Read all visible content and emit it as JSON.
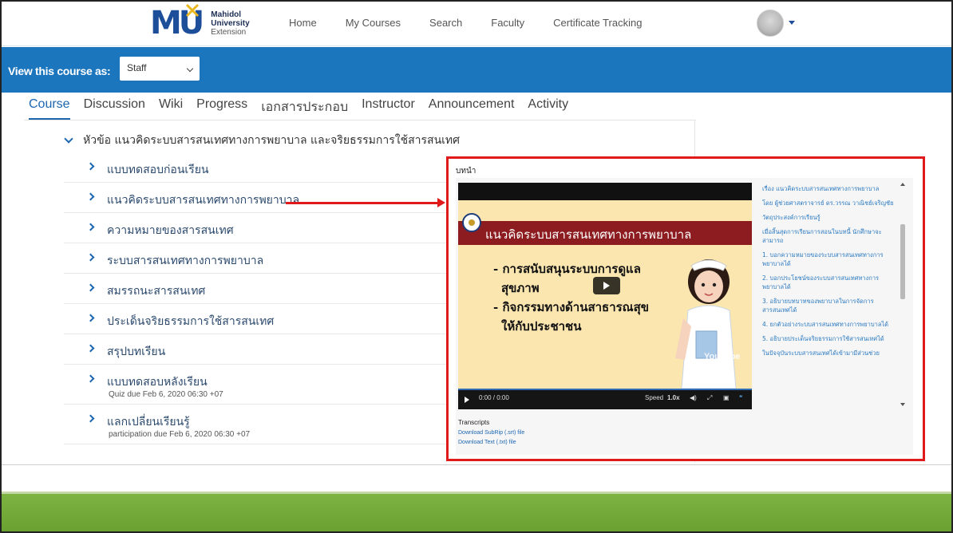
{
  "header": {
    "logo": {
      "mark": "MU",
      "line1": "Mahidol",
      "line2": "University",
      "line3": "Extension"
    },
    "nav": [
      "Home",
      "My Courses",
      "Search",
      "Faculty",
      "Certificate Tracking"
    ]
  },
  "viewbar": {
    "label": "View this course as:",
    "select_value": "Staff"
  },
  "tabs": [
    "Course",
    "Discussion",
    "Wiki",
    "Progress",
    "เอกสารประกอบ",
    "Instructor",
    "Announcement",
    "Activity"
  ],
  "outline": {
    "section_title": "หัวข้อ แนวคิดระบบสารสนเทศทางการพยาบาล และจริยธรรมการใช้สารสนเทศ",
    "items": [
      {
        "label": "แบบทดสอบก่อนเรียน",
        "sub": ""
      },
      {
        "label": "แนวคิดระบบสารสนเทศทางการพยาบาล",
        "sub": ""
      },
      {
        "label": "ความหมายของสารสนเทศ",
        "sub": ""
      },
      {
        "label": "ระบบสารสนเทศทางการพยาบาล",
        "sub": ""
      },
      {
        "label": "สมรรถนะสารสนเทศ",
        "sub": ""
      },
      {
        "label": "ประเด็นจริยธรรมการใช้สารสนเทศ",
        "sub": ""
      },
      {
        "label": "สรุปบทเรียน",
        "sub": ""
      },
      {
        "label": "แบบทดสอบหลังเรียน",
        "sub": "Quiz due Feb 6, 2020 06:30 +07"
      },
      {
        "label": "แลกเปลี่ยนเรียนรู้",
        "sub": "participation due Feb 6, 2020 06:30 +07"
      }
    ]
  },
  "panel": {
    "title": "บทนำ",
    "video": {
      "banner": "แนวคิดระบบสารสนเทศทางการพยาบาล",
      "bullets": [
        "- การสนับสนุนระบบการดูแล",
        "สุขภาพ",
        "- กิจกรรมทางด้านสาธารณสุข",
        "ให้กับประชาชน"
      ],
      "watermark": "YouTube",
      "time": "0:00 / 0:00",
      "speed_label": "Speed",
      "speed_value": "1.0x"
    },
    "transcript_lines": [
      "เรื่อง แนวคิดระบบสารสนเทศทางการพยาบาล",
      "โดย ผู้ช่วยศาสตราจารย์ ดร.วรรณ วาณิชย์เจริญชัย",
      "วัตถุประสงค์การเรียนรู้",
      "เมื่อสิ้นสุดการเรียนการสอนในบทนี้ นักศึกษาจะสามารถ",
      "1. บอกความหมายของระบบสารสนเทศทางการพยาบาลได้",
      "2. บอกประโยชน์ของระบบสารสนเทศทางการพยาบาลได้",
      "3. อธิบายบทบาทของพยาบาลในการจัดการสารสนเทศได้",
      "4. ยกตัวอย่างระบบสารสนเทศทางการพยาบาลได้",
      "5. อธิบายประเด็นจริยธรรมการใช้สารสนเทศได้",
      "ในปัจจุบันระบบสารสนเทศได้เข้ามามีส่วนช่วย"
    ],
    "transcripts_label": "Transcripts",
    "download_srt": "Download SubRip (.srt) file",
    "download_txt": "Download Text (.txt) file"
  },
  "colors": {
    "brand_blue": "#1b76bd",
    "link_blue": "#1d66b0",
    "highlight_red": "#e0191b",
    "footer_green": "#7cb342"
  }
}
